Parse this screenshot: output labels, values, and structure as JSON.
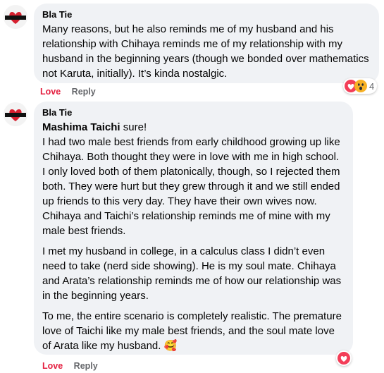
{
  "comments": [
    {
      "author": "Bla Tie",
      "paragraphs": [
        "Many reasons, but he also reminds me of my husband and his relationship with Chihaya reminds me of my relationship with my husband in the beginning years (though we bonded over mathematics not Karuta, initially). It’s kinda nostalgic."
      ],
      "actions": {
        "love": "Love",
        "reply": "Reply"
      },
      "reaction_count": "4"
    },
    {
      "author": "Bla Tie",
      "mention": "Mashima Taichi",
      "mention_rest": " sure!",
      "paragraphs": [
        "I had two male best friends from early childhood growing up like Chihaya. Both thought they were in love with me in high school. I only loved both of them platonically, though, so I rejected them both. They were hurt but they grew through it and we still ended up friends to this very day. They have their own wives now. Chihaya and Taichi’s relationship reminds me of mine with my male best friends.",
        "I met my husband in college, in a calculus class I didn’t even need to take (nerd side showing). He is my soul mate. Chihaya and Arata’s relationship reminds me of how our relationship was in the beginning years.",
        "To me, the entire scenario is completely realistic. The premature love of Taichi like my male best friends, and the soul mate love of Arata like my husband. 🥰"
      ],
      "actions": {
        "love": "Love",
        "reply": "Reply"
      }
    }
  ],
  "colors": {
    "love_red": "#e41e3f",
    "bubble_bg": "#f0f2f5",
    "muted": "#65676b"
  }
}
